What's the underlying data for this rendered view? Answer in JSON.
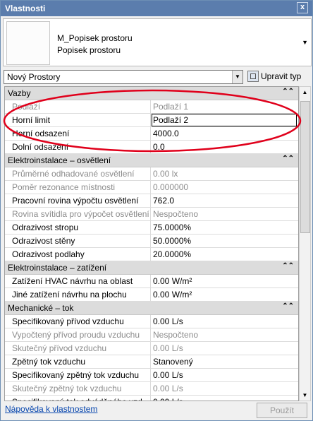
{
  "window": {
    "title": "Vlastnosti",
    "close_glyph": "x"
  },
  "type_selector": {
    "family": "M_Popisek prostoru",
    "type": "Popisek prostoru"
  },
  "instance_filter": {
    "value": "Nový Prostory"
  },
  "edit_type": {
    "label": "Upravit typ"
  },
  "categories": [
    {
      "name": "Vazby",
      "rows": [
        {
          "name": "Podlaží",
          "value": "Podlaží 1",
          "disabled": true
        },
        {
          "name": "Horní limit",
          "value": "Podlaží 2",
          "disabled": false,
          "editing": true
        },
        {
          "name": "Horní odsazení",
          "value": "4000.0",
          "disabled": false
        },
        {
          "name": "Dolní odsazení",
          "value": "0.0",
          "disabled": false
        }
      ]
    },
    {
      "name": "Elektroinstalace – osvětlení",
      "rows": [
        {
          "name": "Průměrné odhadované osvětlení",
          "value": "0.00 lx",
          "disabled": true
        },
        {
          "name": "Poměr rezonance místnosti",
          "value": "0.000000",
          "disabled": true
        },
        {
          "name": "Pracovní rovina výpočtu osvětlení",
          "value": "762.0",
          "disabled": false
        },
        {
          "name": "Rovina svítidla pro výpočet osvětlení",
          "value": "Nespočteno",
          "disabled": true
        },
        {
          "name": "Odrazivost stropu",
          "value": "75.0000%",
          "disabled": false
        },
        {
          "name": "Odrazivost stěny",
          "value": "50.0000%",
          "disabled": false
        },
        {
          "name": "Odrazivost podlahy",
          "value": "20.0000%",
          "disabled": false
        }
      ]
    },
    {
      "name": "Elektroinstalace – zatížení",
      "rows": [
        {
          "name": "Zatížení HVAC návrhu na oblast",
          "value": "0.00 W/m²",
          "disabled": false
        },
        {
          "name": "Jiné zatížení návrhu na plochu",
          "value": "0.00 W/m²",
          "disabled": false
        }
      ]
    },
    {
      "name": "Mechanické – tok",
      "rows": [
        {
          "name": "Specifikovaný přívod vzduchu",
          "value": "0.00 L/s",
          "disabled": false
        },
        {
          "name": "Vypočtený přívod proudu vzduchu",
          "value": "Nespočteno",
          "disabled": true
        },
        {
          "name": "Skutečný přívod vzduchu",
          "value": "0.00 L/s",
          "disabled": true
        },
        {
          "name": "Zpětný tok vzduchu",
          "value": "Stanovený",
          "disabled": false
        },
        {
          "name": "Specifikovaný zpětný tok vzduchu",
          "value": "0.00 L/s",
          "disabled": false
        },
        {
          "name": "Skutečný zpětný tok vzduchu",
          "value": "0.00 L/s",
          "disabled": true
        },
        {
          "name": "Specifikovaný tok odváděného vzd...",
          "value": "0.00 L/s",
          "disabled": false
        },
        {
          "name": "Skutečný tok odváděného vzduchu",
          "value": "0.00 L/s",
          "disabled": true
        }
      ]
    }
  ],
  "collapse_glyph": "⌃⌃",
  "footer": {
    "help_link": "Nápověda k vlastnostem",
    "apply_label": "Použít"
  },
  "colors": {
    "title_bar": "#5b7dad",
    "category_bg": "#dcdcdc",
    "annotation": "#e0001b",
    "link": "#0645ad"
  },
  "icons": {
    "close": "close-icon",
    "dropdown": "chevron-down-icon",
    "edit_type": "edit-type-icon",
    "collapse": "collapse-icon"
  }
}
